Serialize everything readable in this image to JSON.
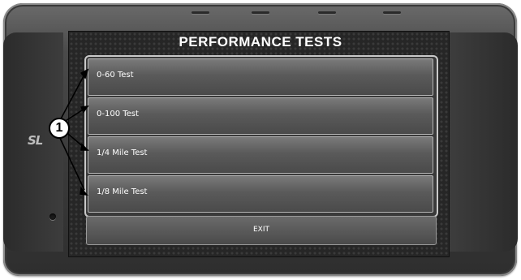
{
  "screen": {
    "title": "PERFORMANCE TESTS"
  },
  "menu": {
    "items": [
      {
        "label": "0-60 Test"
      },
      {
        "label": "0-100 Test"
      },
      {
        "label": "1/4 Mile Test"
      },
      {
        "label": "1/8 Mile Test"
      }
    ],
    "exit_label": "EXIT"
  },
  "device": {
    "logo_text": "SL"
  },
  "annotation": {
    "callout_number": "1"
  },
  "colors": {
    "bezel": "#3a3a3a",
    "screen_bg": "#262626",
    "row_top": "#7a7a7a",
    "row_bottom": "#4a4a4a",
    "border": "#c9c9c9",
    "text": "#ffffff"
  }
}
